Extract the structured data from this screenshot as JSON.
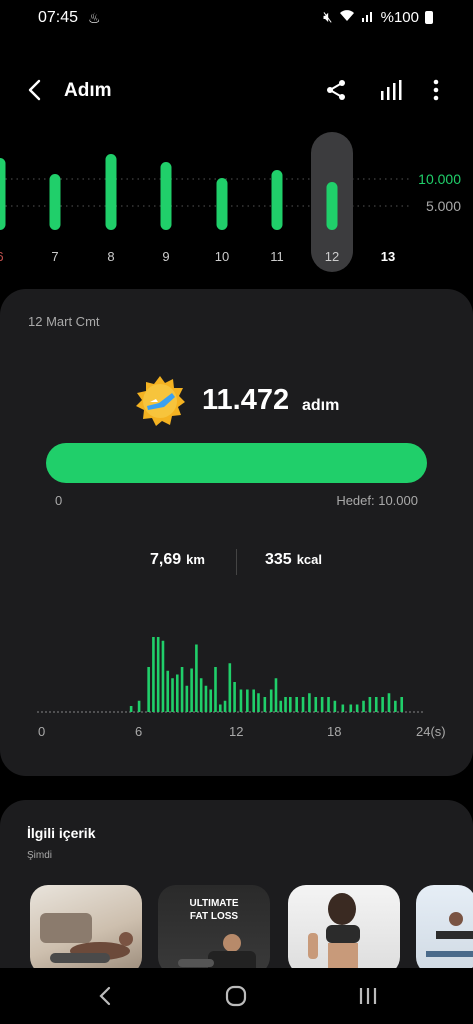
{
  "status": {
    "time": "07:45",
    "battery": "%100"
  },
  "header": {
    "title": "Adım"
  },
  "week": {
    "days": [
      "6",
      "7",
      "8",
      "9",
      "10",
      "11",
      "12",
      "13"
    ],
    "selected_day": "12",
    "current_day": "13",
    "goal_labels": [
      "10.000",
      "5.000"
    ],
    "day_steps": [
      9000,
      7000,
      9500,
      8500,
      6500,
      7500,
      6000,
      0
    ]
  },
  "summary": {
    "date": "12 Mart Cmt",
    "steps": "11.472",
    "steps_unit": "adım",
    "bar_min": "0",
    "goal_text": "Hedef: 10.000",
    "distance": "7,69",
    "distance_unit": "km",
    "calories": "335",
    "calories_unit": "kcal",
    "hour_labels": [
      "0",
      "6",
      "12",
      "18",
      "24(s)"
    ]
  },
  "chart_data": {
    "type": "bar",
    "title": "",
    "xlabel": "",
    "ylabel": "",
    "x_tick_labels": [
      "0",
      "6",
      "12",
      "18",
      "24(s)"
    ],
    "bar_x": [
      5.6,
      6.1,
      6.7,
      7.0,
      7.3,
      7.6,
      7.9,
      8.2,
      8.5,
      8.8,
      9.1,
      9.4,
      9.7,
      10.0,
      10.3,
      10.6,
      10.9,
      11.2,
      11.5,
      11.8,
      12.1,
      12.5,
      12.9,
      13.3,
      13.6,
      14.0,
      14.4,
      14.7,
      15.0,
      15.3,
      15.6,
      16.0,
      16.4,
      16.8,
      17.2,
      17.6,
      18.0,
      18.4,
      18.9,
      19.4,
      19.8,
      20.2,
      20.6,
      21.0,
      21.4,
      21.8,
      22.2,
      22.6
    ],
    "values": [
      8,
      15,
      60,
      100,
      100,
      95,
      55,
      45,
      50,
      60,
      35,
      58,
      90,
      45,
      35,
      30,
      60,
      10,
      15,
      65,
      40,
      30,
      30,
      30,
      25,
      20,
      30,
      45,
      15,
      20,
      20,
      20,
      20,
      25,
      20,
      20,
      20,
      15,
      10,
      10,
      10,
      15,
      20,
      20,
      20,
      25,
      15,
      20
    ],
    "ylim": [
      0,
      100
    ]
  },
  "related": {
    "title": "İlgili içerik",
    "subtitle": "Şimdi",
    "card2_text": "ULTIMATE\nFAT LOSS"
  },
  "colors": {
    "accent": "#20cf6a",
    "card": "#1c1c1e",
    "background": "#000000"
  }
}
